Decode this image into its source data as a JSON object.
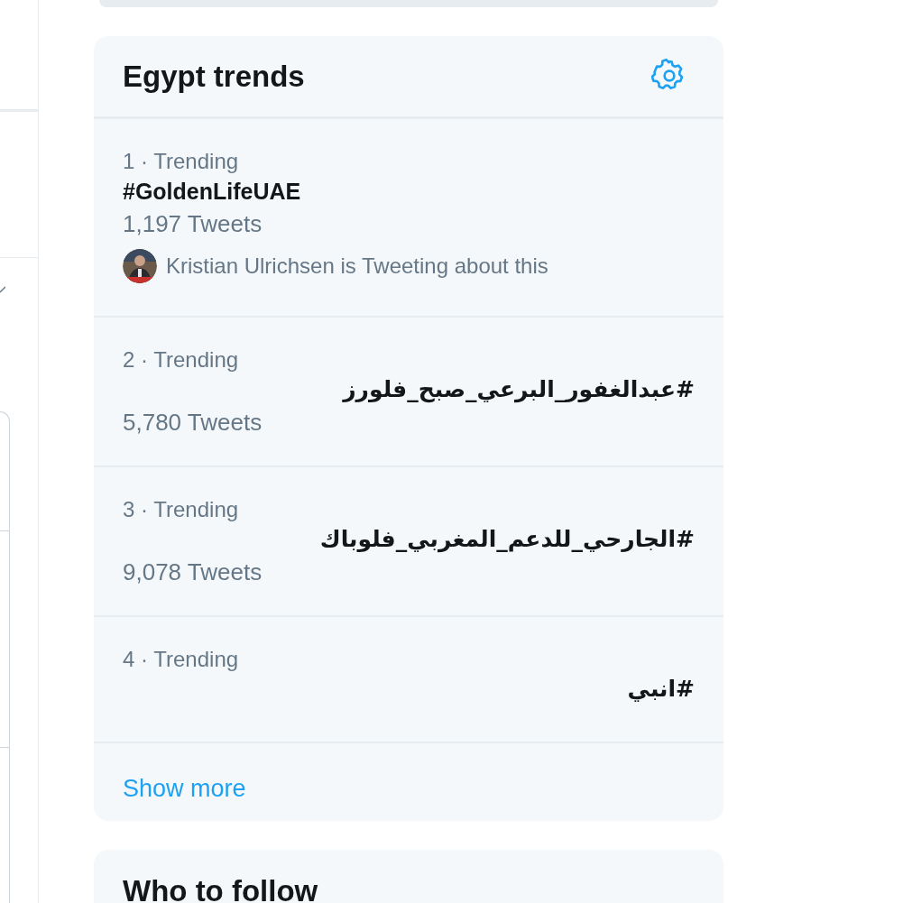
{
  "trends_panel": {
    "title": "Egypt trends",
    "trends": [
      {
        "meta": "1 · Trending",
        "topic": "#GoldenLifeUAE",
        "rtl": false,
        "count": "1,197 Tweets",
        "context": "Kristian Ulrichsen is Tweeting about this"
      },
      {
        "meta": "2 · Trending",
        "topic": "#عبدالغفور_البرعي_صبح_فلورز",
        "rtl": true,
        "count": "5,780 Tweets"
      },
      {
        "meta": "3 · Trending",
        "topic": "#الجارحي_للدعم_المغربي_فلوباك",
        "rtl": true,
        "count": "9,078 Tweets"
      },
      {
        "meta": "4 · Trending",
        "topic": "#انبي",
        "rtl": true
      }
    ],
    "show_more": "Show more"
  },
  "who_to_follow": {
    "title": "Who to follow"
  }
}
